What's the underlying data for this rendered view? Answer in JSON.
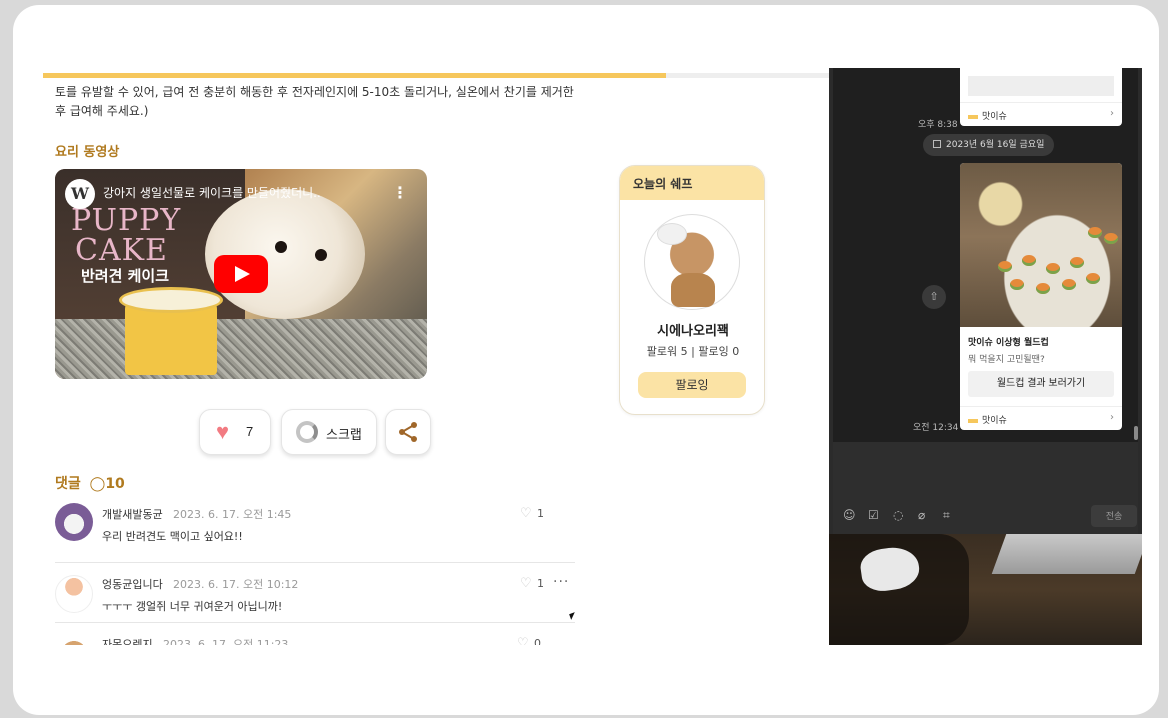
{
  "article": {
    "progress_percent": 79,
    "intro_text": "토를 유발할 수 있어, 급여 전 충분히 해동한 후 전자레인지에 5-10초 돌리거나, 실온에서 찬기를 제거한 후 급여해 주세요.)",
    "video_section_title": "요리 동영상",
    "video": {
      "channel_logo": "W",
      "title": "강아지 생일선물로 케이크를 만들어줬더니..",
      "overlay_line1": "PUPPY",
      "overlay_line2": "CAKE",
      "overlay_line3": "반려견 케이크",
      "menu_icon": "⋮"
    },
    "actions": {
      "like_icon": "heart-icon",
      "like_count": "7",
      "scrap_label": "스크랩",
      "share_icon": "share-icon"
    },
    "comments": {
      "title": "댓글",
      "count": "10",
      "bubble_glyph": "◯",
      "items": [
        {
          "author": "개발새발동균",
          "date": "2023. 6. 17. 오전 1:45",
          "text": "우리 반려견도 맥이고 싶어요!!",
          "likes": "1"
        },
        {
          "author": "엉동균입니다",
          "date": "2023. 6. 17. 오전 10:12",
          "text": "ㅜㅜㅜ 갱얼쥐 너무 귀여운거 아닙니까!",
          "likes": "1",
          "more": "···"
        },
        {
          "author": "자몽오렌지",
          "date": "2023. 6. 17. 오전 11:23",
          "text": "",
          "likes": "0"
        }
      ],
      "heart_glyph": "♡"
    }
  },
  "chef_card": {
    "header": "오늘의 쉐프",
    "name": "시에나오리꽥",
    "stats": "팔로워 5 | 팔로잉 0",
    "follow_label": "팔로잉"
  },
  "chat": {
    "top_source": "맛이슈",
    "time1": "오후 8:38",
    "date_chip": "2023년 6월 16일 금요일",
    "share_glyph": "⇧",
    "food_card": {
      "title": "맛이슈 이상형 월드컵",
      "subtitle": "뭐 먹을지 고민될땐?",
      "button": "월드컵 결과 보러가기",
      "source": "맛이슈",
      "arrow": "›"
    },
    "time2": "오전 12:34",
    "tool_glyphs": [
      "☺",
      "☑",
      "◌",
      "⌀",
      "⌗"
    ],
    "send_label": "전송"
  },
  "colors": {
    "accent": "#f6c75c",
    "section_title": "#b07a1f",
    "heart": "#f27b82",
    "chef_header": "#fbe3a5",
    "youtube_red": "#ff0000"
  }
}
